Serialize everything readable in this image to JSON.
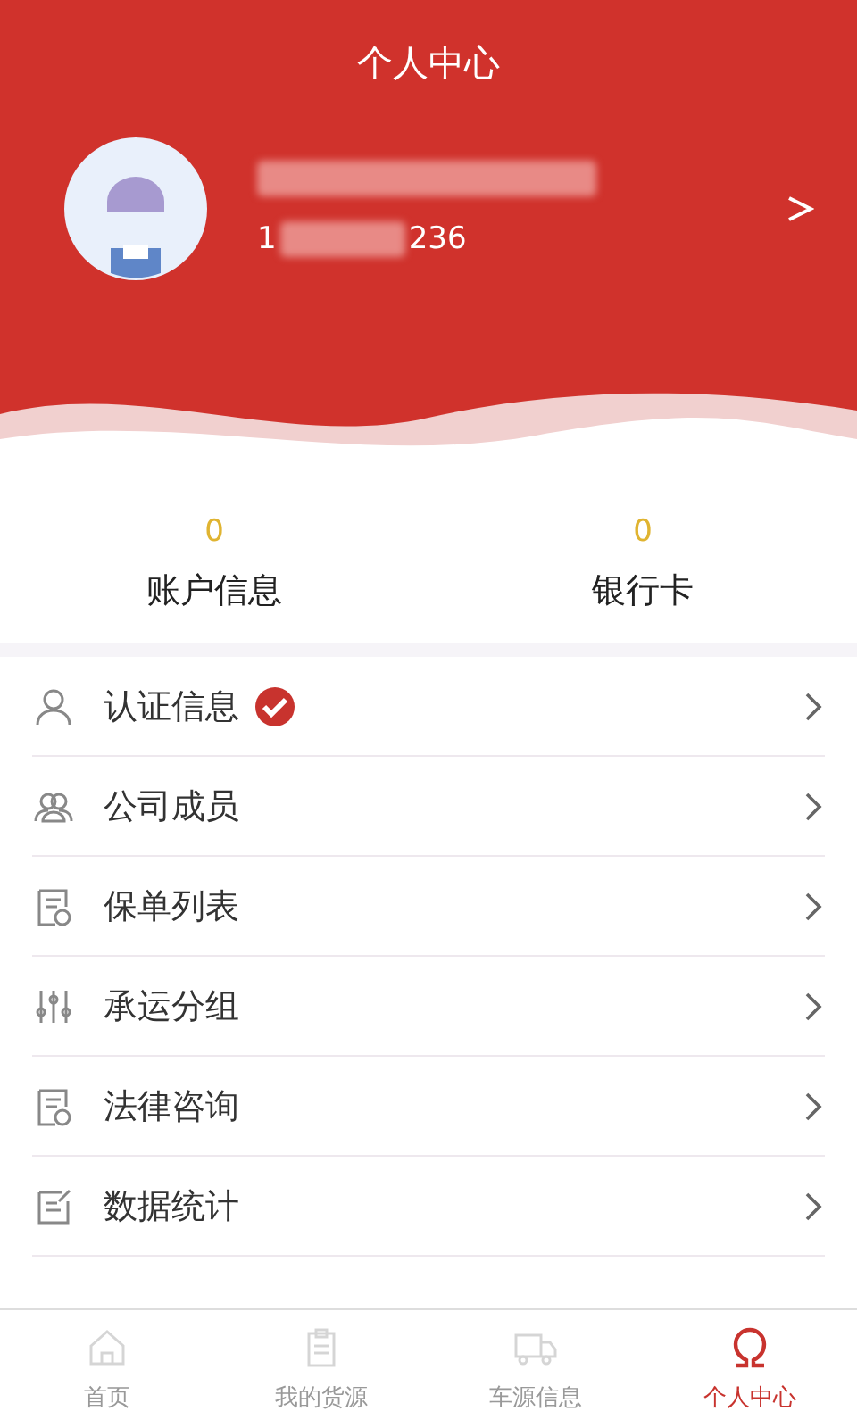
{
  "header": {
    "title": "个人中心",
    "phone_start": "1",
    "phone_end": "236"
  },
  "stats": [
    {
      "value": "0",
      "label": "账户信息"
    },
    {
      "value": "0",
      "label": "银行卡"
    }
  ],
  "menu": [
    {
      "label": "认证信息",
      "verified": true
    },
    {
      "label": "公司成员",
      "verified": false
    },
    {
      "label": "保单列表",
      "verified": false
    },
    {
      "label": "承运分组",
      "verified": false
    },
    {
      "label": "法律咨询",
      "verified": false
    },
    {
      "label": "数据统计",
      "verified": false
    }
  ],
  "tabs": [
    {
      "label": "首页",
      "selected": false
    },
    {
      "label": "我的货源",
      "selected": false
    },
    {
      "label": "车源信息",
      "selected": false
    },
    {
      "label": "个人中心",
      "selected": true
    }
  ]
}
